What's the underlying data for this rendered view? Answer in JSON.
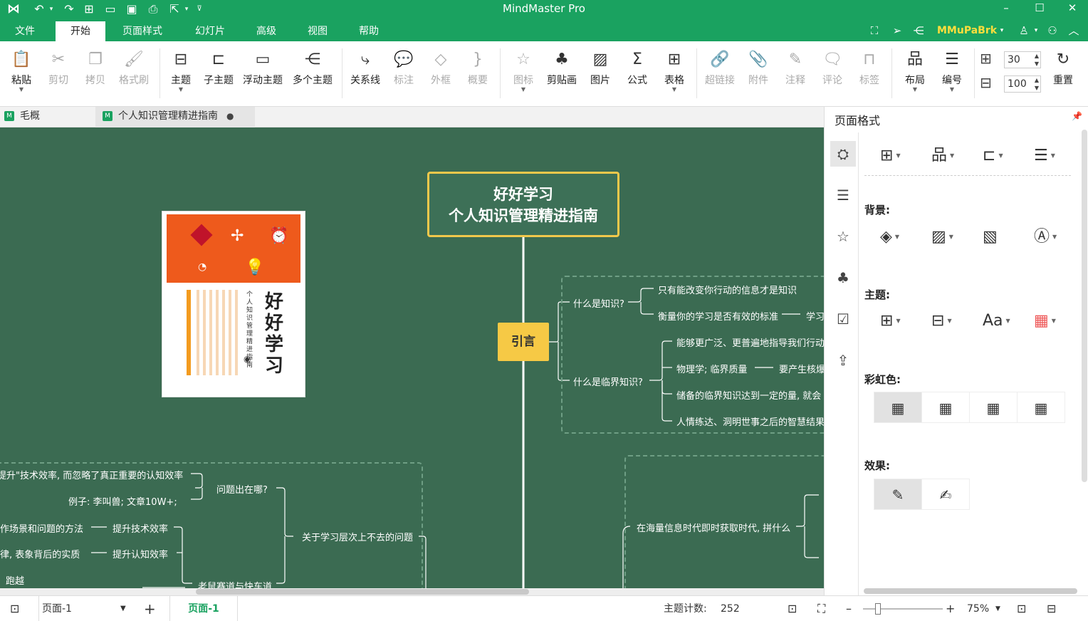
{
  "app": {
    "title": "MindMaster Pro",
    "user": "MMuPaBrk"
  },
  "menu": {
    "tabs": [
      "文件",
      "开始",
      "页面样式",
      "幻灯片",
      "高级",
      "视图",
      "帮助"
    ],
    "active": "开始"
  },
  "ribbon": {
    "paste": "粘贴",
    "cut": "剪切",
    "copy": "拷贝",
    "format_brush": "格式刷",
    "topic": "主题",
    "subtopic": "子主题",
    "floating": "浮动主题",
    "multi": "多个主题",
    "relation": "关系线",
    "callout": "标注",
    "boundary": "外框",
    "summary": "概要",
    "icon": "图标",
    "clipart": "剪贴画",
    "picture": "图片",
    "formula": "公式",
    "table": "表格",
    "hyperlink": "超链接",
    "attachment": "附件",
    "note": "注释",
    "comment": "评论",
    "tag": "标签",
    "layout": "布局",
    "numbering": "编号",
    "spacing1": "30",
    "spacing2": "100",
    "reset": "重置"
  },
  "doc_tabs": [
    {
      "label": "毛概"
    },
    {
      "label": "个人知识管理精进指南"
    }
  ],
  "panel": {
    "title": "页面格式",
    "background_label": "背景:",
    "theme_label": "主题:",
    "rainbow_label": "彩虹色:",
    "effect_label": "效果:"
  },
  "mindmap": {
    "root_line1": "好好学习",
    "root_line2": "个人知识管理精进指南",
    "intro": "引言",
    "intro_branches": {
      "what_knowledge": "什么是知识?",
      "k1": "只有能改变你行动的信息才是知识",
      "k2": "衡量你的学习是否有效的标准",
      "k2_tail": "学习",
      "what_critical": "什么是临界知识?",
      "c1": "能够更广泛、更普遍地指导我们行动",
      "c2": "物理学; 临界质量",
      "c2_tail": "要产生核爆",
      "c3": "储备的临界知识达到一定的量, 就会",
      "c4": "人情练达、洞明世事之后的智慧结果"
    },
    "left_branches": {
      "l1": "提升\"技术效率, 而忽略了真正重要的认知效率",
      "problem": "问题出在哪?",
      "example": "例子: 李叫兽; 文章10W+;",
      "l2": "作场景和问题的方法",
      "tech_eff": "提升技术效率",
      "l3": "律, 表象背后的实质",
      "cog_eff": "提升认知效率",
      "stuck": "关于学习层次上不去的问题",
      "run": "跑越",
      "mouse": "老鼠赛道与快车道"
    },
    "right_bottom": "在海量信息时代即时获取时代, 拼什么"
  },
  "book": {
    "title": "好好学习",
    "subtitle": "个人知识管理精进指南"
  },
  "status": {
    "page_select": "页面-1",
    "page_tab": "页面-1",
    "topic_count_label": "主题计数:",
    "topic_count": "252",
    "zoom": "75%"
  }
}
